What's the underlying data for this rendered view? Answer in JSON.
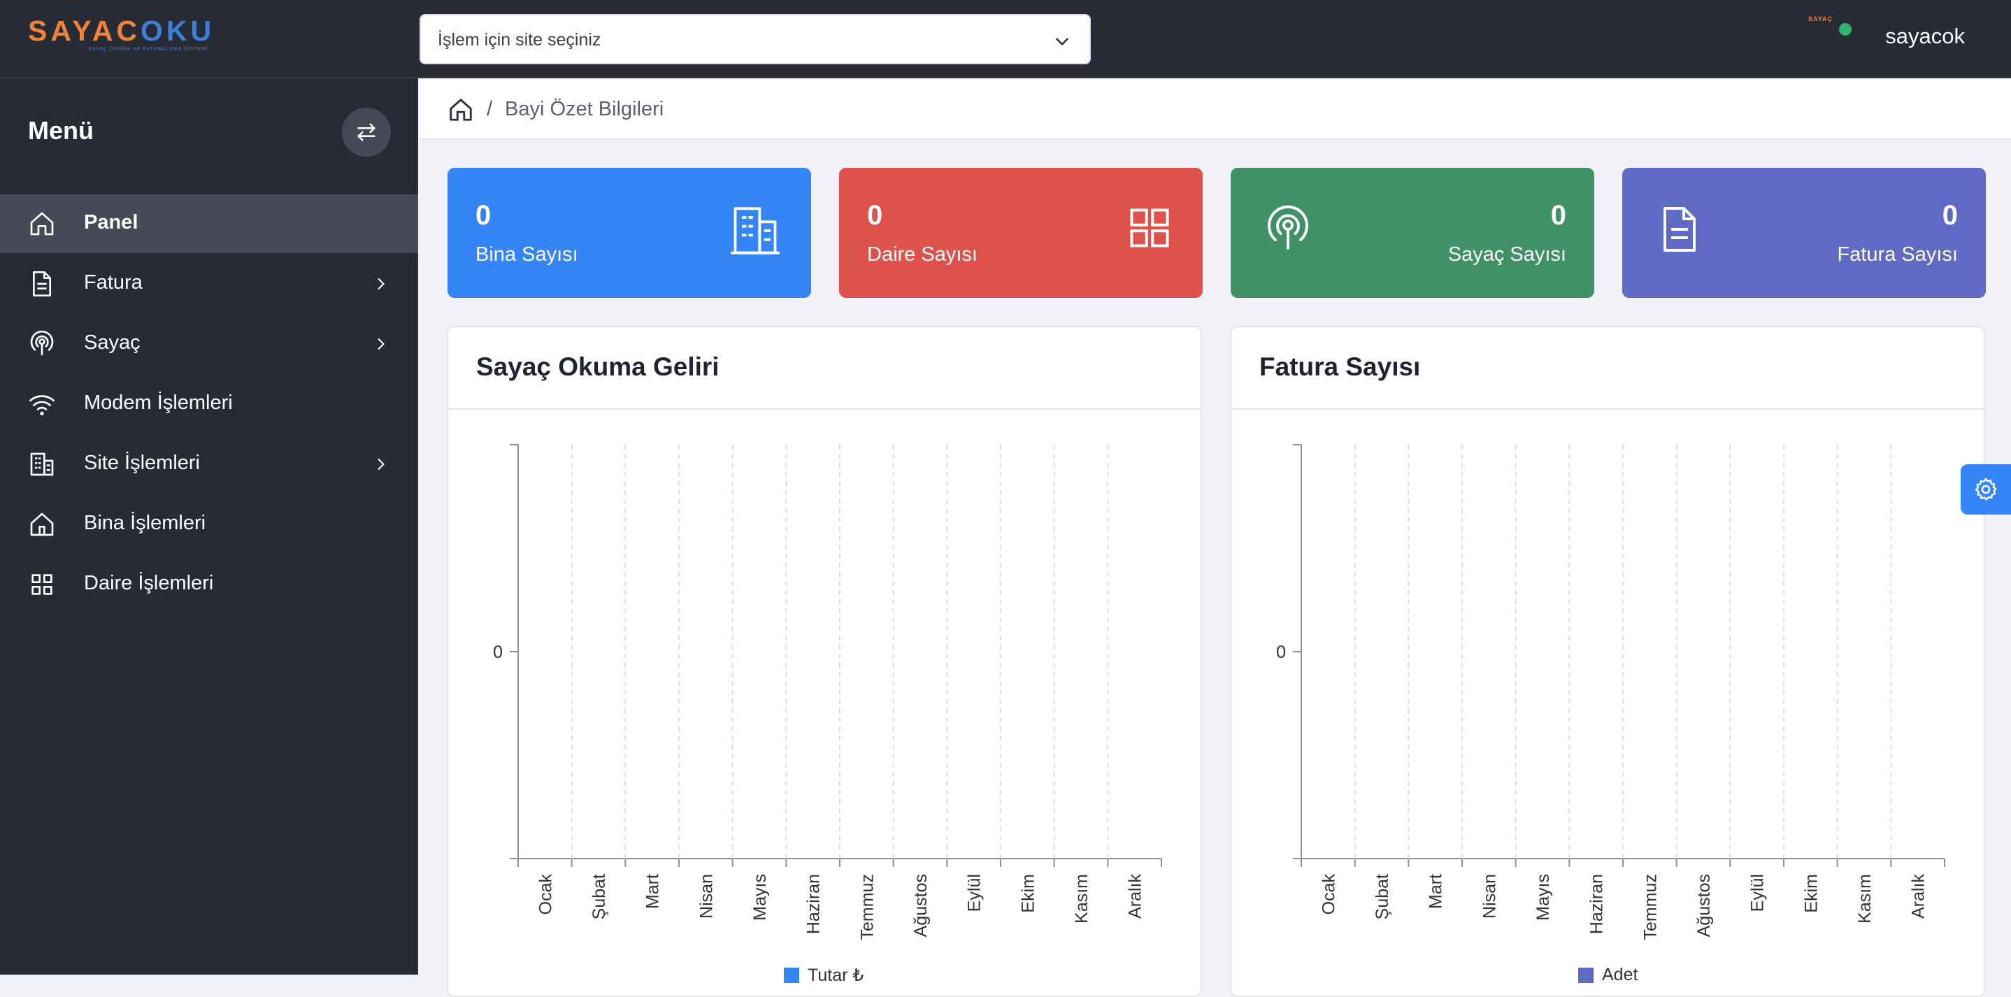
{
  "brand": {
    "logo_part1": "SAYAC",
    "logo_part2": "OKU",
    "logo_tagline": "SAYAÇ OKUMA VE FATURALAMA SİSTEMİ",
    "user_mini_logo": "SAYAÇ"
  },
  "topbar": {
    "site_select_placeholder": "İşlem için site seçiniz",
    "username": "sayacok"
  },
  "sidebar": {
    "title": "Menü",
    "items": [
      {
        "label": "Panel",
        "icon": "home-icon",
        "active": true,
        "has_submenu": false
      },
      {
        "label": "Fatura",
        "icon": "file-icon",
        "active": false,
        "has_submenu": true
      },
      {
        "label": "Sayaç",
        "icon": "podcast-icon",
        "active": false,
        "has_submenu": true
      },
      {
        "label": "Modem İşlemleri",
        "icon": "wifi-icon",
        "active": false,
        "has_submenu": false
      },
      {
        "label": "Site İşlemleri",
        "icon": "buildings-icon",
        "active": false,
        "has_submenu": true
      },
      {
        "label": "Bina İşlemleri",
        "icon": "house-icon",
        "active": false,
        "has_submenu": false
      },
      {
        "label": "Daire İşlemleri",
        "icon": "grid-icon",
        "active": false,
        "has_submenu": false
      }
    ]
  },
  "breadcrumb": {
    "separator": "/",
    "current": "Bayi Özet Bilgileri"
  },
  "stats": [
    {
      "value": "0",
      "label": "Bina Sayısı",
      "color": "#3585f7",
      "icon": "building-icon"
    },
    {
      "value": "0",
      "label": "Daire Sayısı",
      "color": "#df514b",
      "icon": "grid-icon"
    },
    {
      "value": "0",
      "label": "Sayaç Sayısı",
      "color": "#419167",
      "icon": "podcast-icon"
    },
    {
      "value": "0",
      "label": "Fatura Sayısı",
      "color": "#5e6ac3",
      "icon": "document-icon"
    }
  ],
  "chart_data": [
    {
      "type": "bar",
      "title": "Sayaç Okuma Geliri",
      "categories": [
        "Ocak",
        "Şubat",
        "Mart",
        "Nisan",
        "Mayıs",
        "Haziran",
        "Temmuz",
        "Ağustos",
        "Eylül",
        "Ekim",
        "Kasım",
        "Aralık"
      ],
      "series": [
        {
          "name": "Tutar ₺",
          "values": [
            0,
            0,
            0,
            0,
            0,
            0,
            0,
            0,
            0,
            0,
            0,
            0
          ],
          "color": "#3585f7"
        }
      ],
      "y_ticks": [
        "0"
      ],
      "grid": "vertical-dashed",
      "legend": "bottom"
    },
    {
      "type": "bar",
      "title": "Fatura Sayısı",
      "categories": [
        "Ocak",
        "Şubat",
        "Mart",
        "Nisan",
        "Mayıs",
        "Haziran",
        "Temmuz",
        "Ağustos",
        "Eylül",
        "Ekim",
        "Kasım",
        "Aralık"
      ],
      "series": [
        {
          "name": "Adet",
          "values": [
            0,
            0,
            0,
            0,
            0,
            0,
            0,
            0,
            0,
            0,
            0,
            0
          ],
          "color": "#5e6ac3"
        }
      ],
      "y_ticks": [
        "0"
      ],
      "grid": "vertical-dashed",
      "legend": "bottom"
    }
  ]
}
